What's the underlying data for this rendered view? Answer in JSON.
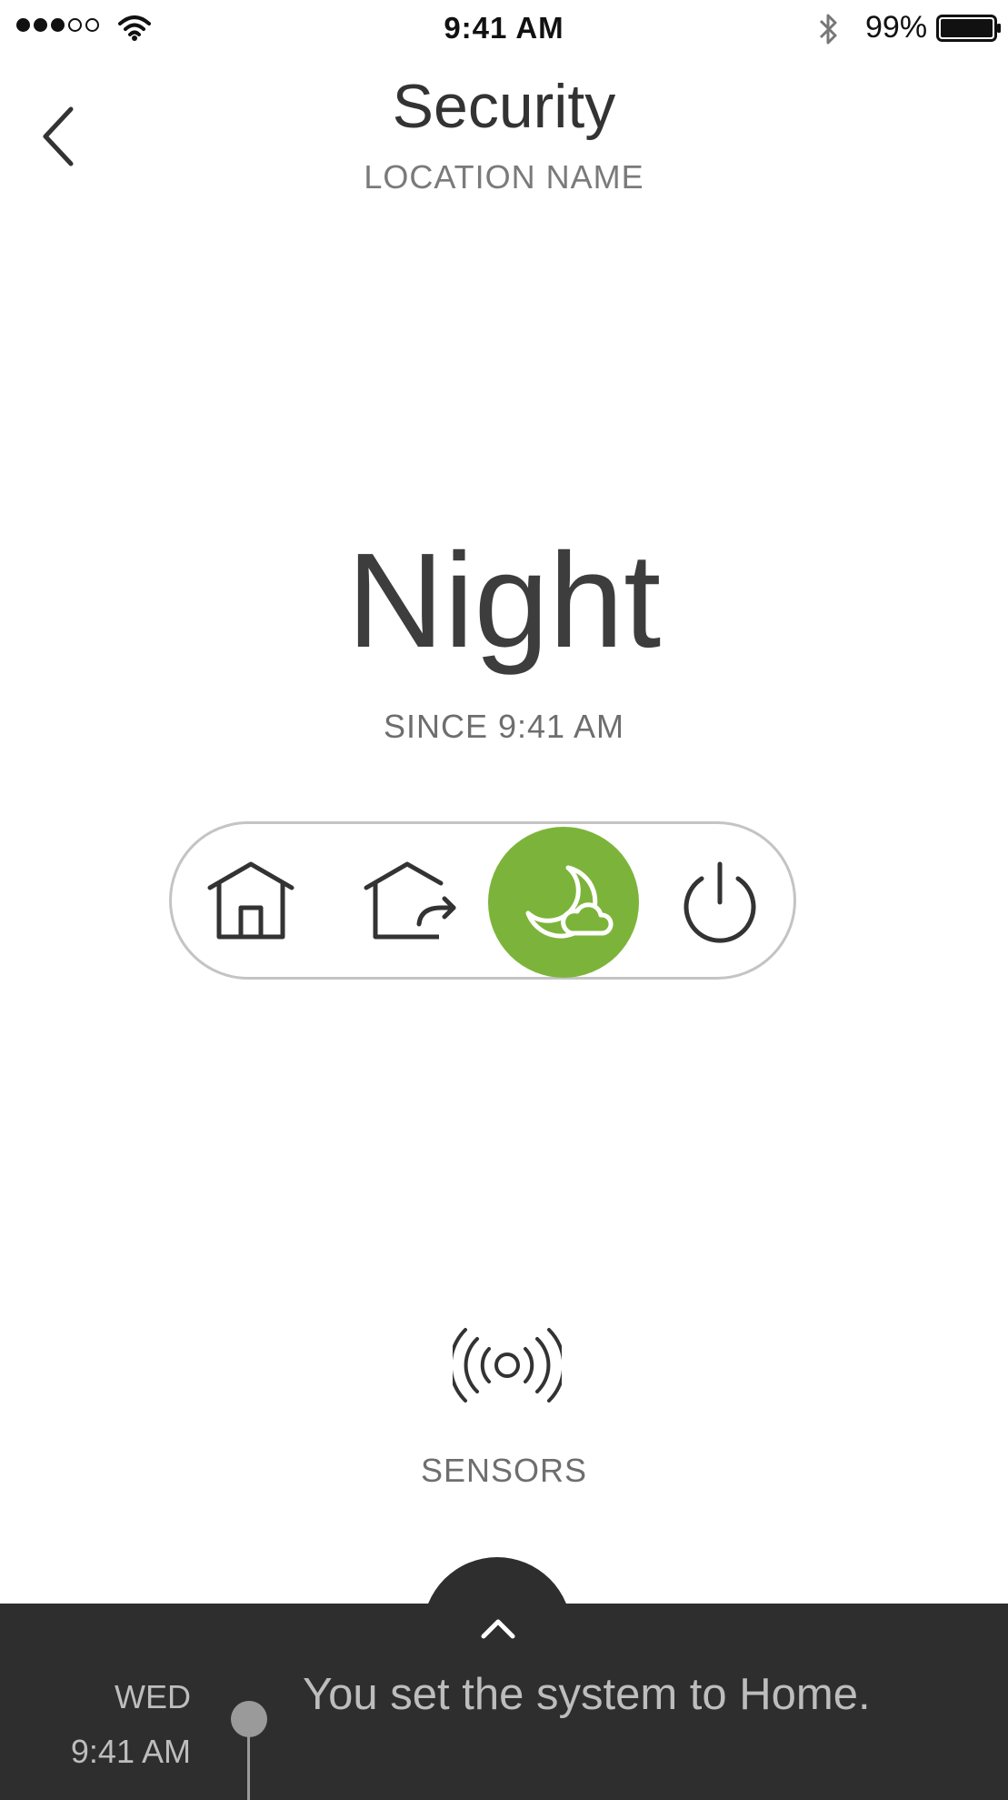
{
  "status_bar": {
    "time": "9:41 AM",
    "battery_percent": "99%",
    "signal_bars": 3,
    "signal_total": 5
  },
  "header": {
    "title": "Security",
    "subtitle": "LOCATION NAME"
  },
  "mode": {
    "name": "Night",
    "since": "SINCE 9:41 AM",
    "options": [
      {
        "id": "home",
        "icon": "home-icon",
        "active": false
      },
      {
        "id": "away",
        "icon": "away-icon",
        "active": false
      },
      {
        "id": "night",
        "icon": "night-icon",
        "active": true
      },
      {
        "id": "off",
        "icon": "power-icon",
        "active": false
      }
    ],
    "active_color": "#7cb43b"
  },
  "sensors": {
    "label": "SENSORS",
    "icon": "sensors-icon"
  },
  "activity": {
    "items": [
      {
        "day": "WED",
        "time": "9:41 AM",
        "text": "You set the system to Home."
      }
    ]
  },
  "colors": {
    "panel_bg": "#2e2e2e",
    "text_dark": "#333333",
    "text_muted": "#6e6e6e"
  }
}
